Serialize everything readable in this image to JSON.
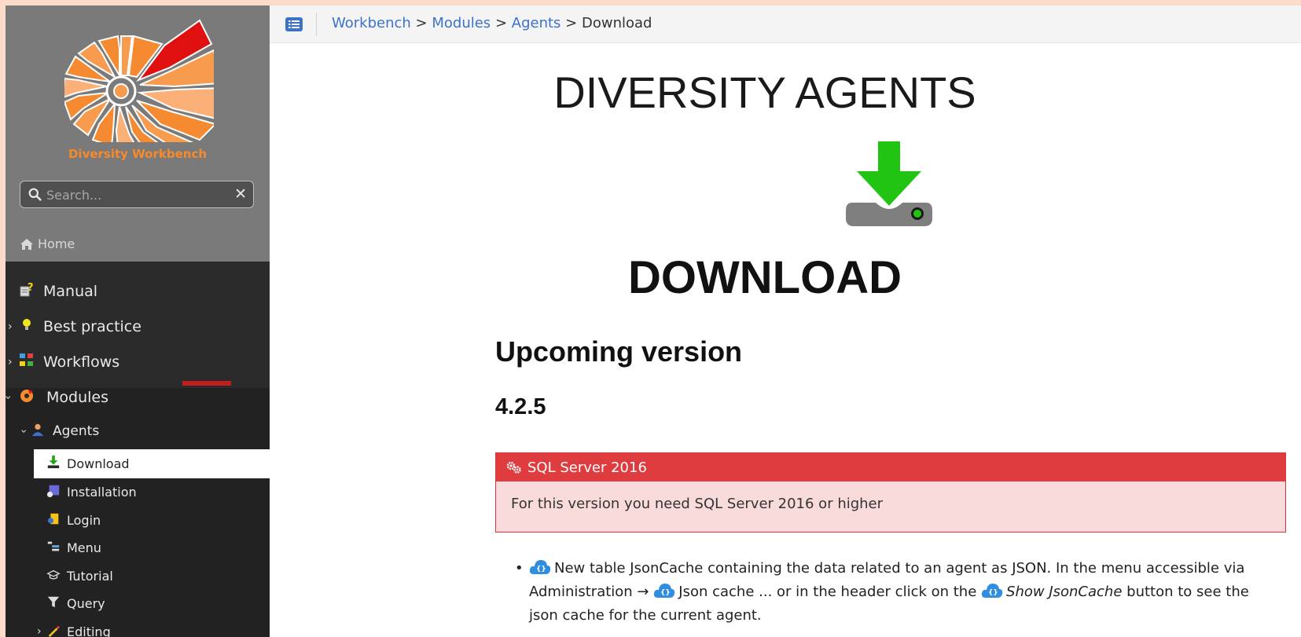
{
  "sidebar": {
    "brand": "Diversity Workbench",
    "search_placeholder": "Search...",
    "search_clear": "✕",
    "home_label": "Home",
    "items": [
      {
        "label": "Manual",
        "icon": "manual-icon"
      },
      {
        "label": "Best practice",
        "icon": "lightbulb-icon"
      },
      {
        "label": "Workflows",
        "icon": "workflow-icon"
      },
      {
        "label": "Modules",
        "icon": "modules-icon"
      },
      {
        "label": "Agents",
        "icon": "agent-icon"
      },
      {
        "label": "Download",
        "icon": "download-icon"
      },
      {
        "label": "Installation",
        "icon": "installation-icon"
      },
      {
        "label": "Login",
        "icon": "login-icon"
      },
      {
        "label": "Menu",
        "icon": "menu-icon"
      },
      {
        "label": "Tutorial",
        "icon": "tutorial-icon"
      },
      {
        "label": "Query",
        "icon": "query-icon"
      },
      {
        "label": "Editing",
        "icon": "editing-icon"
      }
    ]
  },
  "breadcrumb": {
    "items": [
      "Workbench",
      "Modules",
      "Agents"
    ],
    "current": "Download",
    "separator": ">"
  },
  "page": {
    "title": "DIVERSITY AGENTS",
    "download_heading": "DOWNLOAD",
    "section_heading": "Upcoming version",
    "version": "4.2.5",
    "alert": {
      "title": "SQL Server 2016",
      "body": "For this version you need SQL Server 2016 or higher"
    },
    "changes": {
      "part1": "New table JsonCache containing the data related to an agent as JSON. In the menu accessible via Administration →",
      "part2": "Json cache ... or in the header click on the",
      "part3_em": "Show JsonCache",
      "part4": "button to see the json cache for the current agent."
    }
  },
  "colors": {
    "brand_orange": "#f68a2c",
    "link_blue": "#3d72c9",
    "alert_red": "#df3c3f",
    "alert_bg": "#fadbdb",
    "download_green": "#22c414"
  }
}
